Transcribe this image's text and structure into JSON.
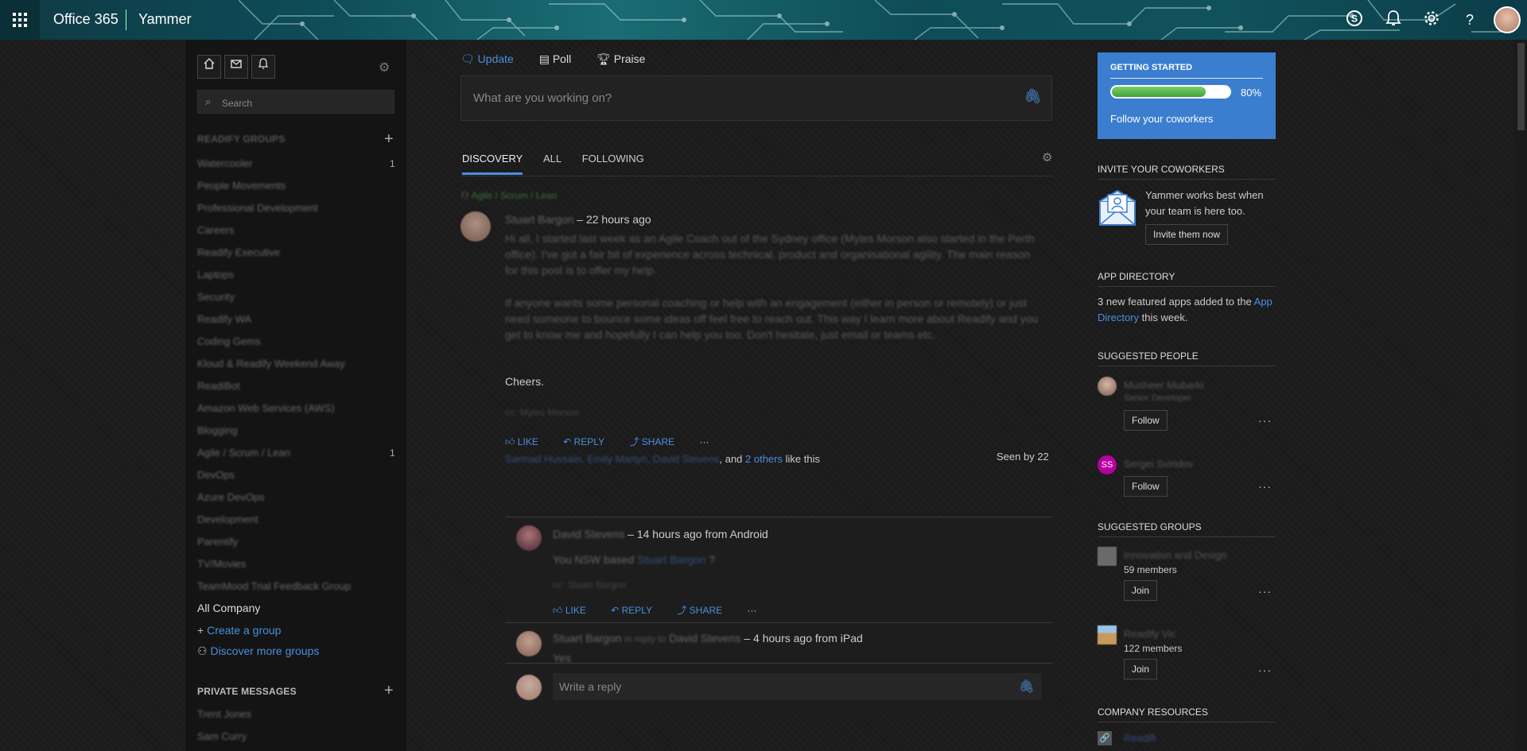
{
  "topbar": {
    "brand": "Office 365",
    "app": "Yammer",
    "icons": [
      "skype-icon",
      "bell-icon",
      "gear-icon",
      "help-icon"
    ],
    "help_glyph": "?"
  },
  "left": {
    "search_placeholder": "Search",
    "groups_header": "READIFY GROUPS",
    "groups": [
      {
        "name": "Watercooler",
        "count": "1"
      },
      {
        "name": "People Movements",
        "count": ""
      },
      {
        "name": "Professional Development",
        "count": ""
      },
      {
        "name": "Careers",
        "count": ""
      },
      {
        "name": "Readify Executive",
        "count": ""
      },
      {
        "name": "Laptops",
        "count": ""
      },
      {
        "name": "Security",
        "count": ""
      },
      {
        "name": "Readify WA",
        "count": ""
      },
      {
        "name": "Coding Gems",
        "count": ""
      },
      {
        "name": "Kloud & Readify Weekend Away",
        "count": ""
      },
      {
        "name": "ReadiBot",
        "count": ""
      },
      {
        "name": "Amazon Web Services (AWS)",
        "count": ""
      },
      {
        "name": "Blogging",
        "count": ""
      },
      {
        "name": "Agile / Scrum / Lean",
        "count": "1"
      },
      {
        "name": "DevOps",
        "count": ""
      },
      {
        "name": "Azure DevOps",
        "count": ""
      },
      {
        "name": "Development",
        "count": ""
      },
      {
        "name": "Parentify",
        "count": ""
      },
      {
        "name": "TV/Movies",
        "count": ""
      },
      {
        "name": "TeamMood Trial Feedback Group",
        "count": ""
      }
    ],
    "all_company": "All Company",
    "create_group": "Create a group",
    "discover_groups": "Discover more groups",
    "pm_header": "PRIVATE MESSAGES",
    "pm": [
      "Trent Jones",
      "Sam Curry"
    ]
  },
  "publisher": {
    "tabs": [
      "Update",
      "Poll",
      "Praise"
    ],
    "placeholder": "What are you working on?"
  },
  "feed_tabs": [
    "DISCOVERY",
    "ALL",
    "FOLLOWING"
  ],
  "post": {
    "group": "Agile / Scrum / Lean",
    "author": "Stuart Bargon",
    "time": "– 22 hours ago",
    "body1": "Hi all, I started last week as an Agile Coach out of the Sydney office (Myles Morson also started in the Perth office). I've got a fair bit of experience across technical, product and organisational agility. The main reason for this post is to offer my help.",
    "body2": "If anyone wants some personal coaching or help with an engagement (either in person or remotely) or just need someone to bounce some ideas off feel free to reach out. This way I learn more about Readify and you get to know me and hopefully I can help you too. Don't hesitate, just email or teams etc.",
    "cheers": "Cheers.",
    "cc": "cc: Myles Morson",
    "actions": [
      "LIKE",
      "REPLY",
      "SHARE",
      "···"
    ],
    "likers": "Sarmad Hussain, Emily Martyn, David Stevens",
    "likes_mid": ", and ",
    "likes_others": "2 others",
    "likes_tail": " like this",
    "seen": "Seen by 22"
  },
  "replies": [
    {
      "author": "David Stevens",
      "meta": "– 14 hours ago from Android",
      "text_pre": "You NSW based ",
      "mention": "Stuart Bargon",
      "text_post": " ?",
      "cc": "cc: Stuart Bargon"
    },
    {
      "author": "Stuart Bargon",
      "inreply": "in reply to",
      "to": "David Stevens",
      "meta": "– 4 hours ago from iPad",
      "text": "Yes"
    }
  ],
  "write_reply": "Write a reply",
  "right": {
    "getting_started": "GETTING STARTED",
    "progress": 0.8,
    "progress_label": "80%",
    "follow_text": "Follow your coworkers",
    "invite_head": "INVITE YOUR COWORKERS",
    "invite_text": "Yammer works best when your team is here too.",
    "invite_btn": "Invite them now",
    "appdir_head": "APP DIRECTORY",
    "appdir_pre": "3 new featured apps added to the ",
    "appdir_link": "App Directory",
    "appdir_post": " this week.",
    "people_head": "SUGGESTED PEOPLE",
    "people": [
      {
        "name": "Musheer Mubarki",
        "title": "Senior Developer",
        "btn": "Follow"
      },
      {
        "name": "Sergei Sviridov",
        "initials": "SS",
        "btn": "Follow"
      }
    ],
    "groups_head": "SUGGESTED GROUPS",
    "sgroups": [
      {
        "name": "Innovation and Design",
        "members": "59 members",
        "btn": "Join"
      },
      {
        "name": "Readify Vic",
        "members": "122 members",
        "btn": "Join"
      }
    ],
    "resources_head": "COMPANY RESOURCES",
    "resource": "Readifi",
    "dots": "···"
  },
  "colors": {
    "accent": "#4a8fde",
    "bg": "#1b1b1b",
    "banner": "#3b7ed0",
    "progress": "#5dbb4f"
  }
}
